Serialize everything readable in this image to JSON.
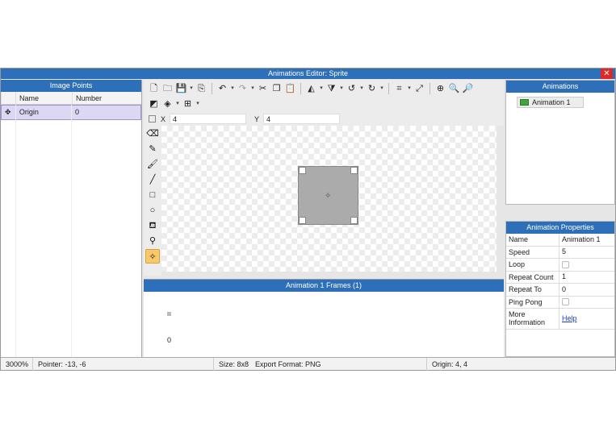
{
  "window": {
    "title": "Animations Editor: Sprite",
    "close_icon": "close-icon"
  },
  "image_points": {
    "header": "Image Points",
    "columns": [
      "Name",
      "Number"
    ],
    "rows": [
      {
        "icon": "crosshair-icon",
        "name": "Origin",
        "number": "0"
      }
    ]
  },
  "toolbar": {
    "x_label": "X",
    "x_value": "4",
    "y_label": "Y",
    "y_value": "4"
  },
  "frames": {
    "header": "Animation 1 Frames (1)",
    "frame_number": "0"
  },
  "animations": {
    "header": "Animations",
    "items": [
      "Animation 1"
    ]
  },
  "properties": {
    "header": "Animation Properties",
    "rows": [
      {
        "key": "Name",
        "value": "Animation 1"
      },
      {
        "key": "Speed",
        "value": "5"
      },
      {
        "key": "Loop",
        "value": ""
      },
      {
        "key": "Repeat Count",
        "value": "1"
      },
      {
        "key": "Repeat To",
        "value": "0"
      },
      {
        "key": "Ping Pong",
        "value": ""
      },
      {
        "key": "More Information",
        "value": "Help"
      }
    ]
  },
  "status": {
    "zoom": "3000%",
    "pointer": "Pointer: -13, -6",
    "size": "Size: 8x8",
    "export": "Export Format: PNG",
    "origin": "Origin: 4, 4"
  },
  "colors": {
    "accent": "#2d6fb8",
    "close": "#e02828",
    "selection": "#dcd8f4",
    "active_tool": "#f7c96b"
  }
}
